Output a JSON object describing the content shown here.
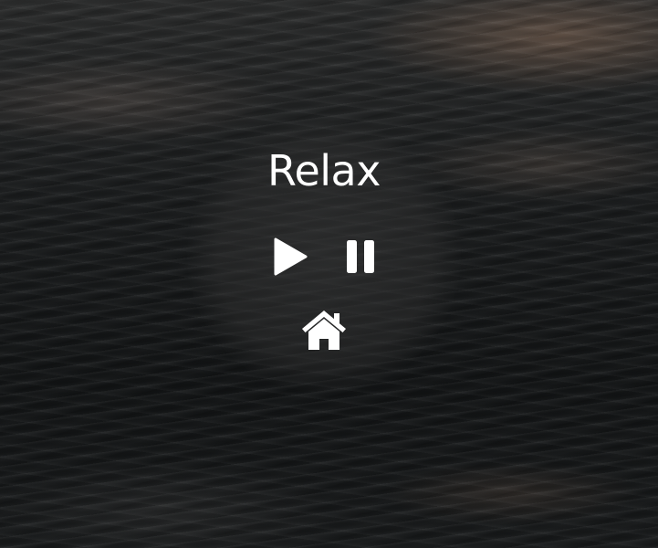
{
  "app": {
    "title": "Relax"
  },
  "controls": {
    "play_icon": "play-icon",
    "pause_icon": "pause-icon",
    "home_icon": "home-icon"
  },
  "colors": {
    "text": "#ffffff",
    "icon": "#ffffff"
  }
}
